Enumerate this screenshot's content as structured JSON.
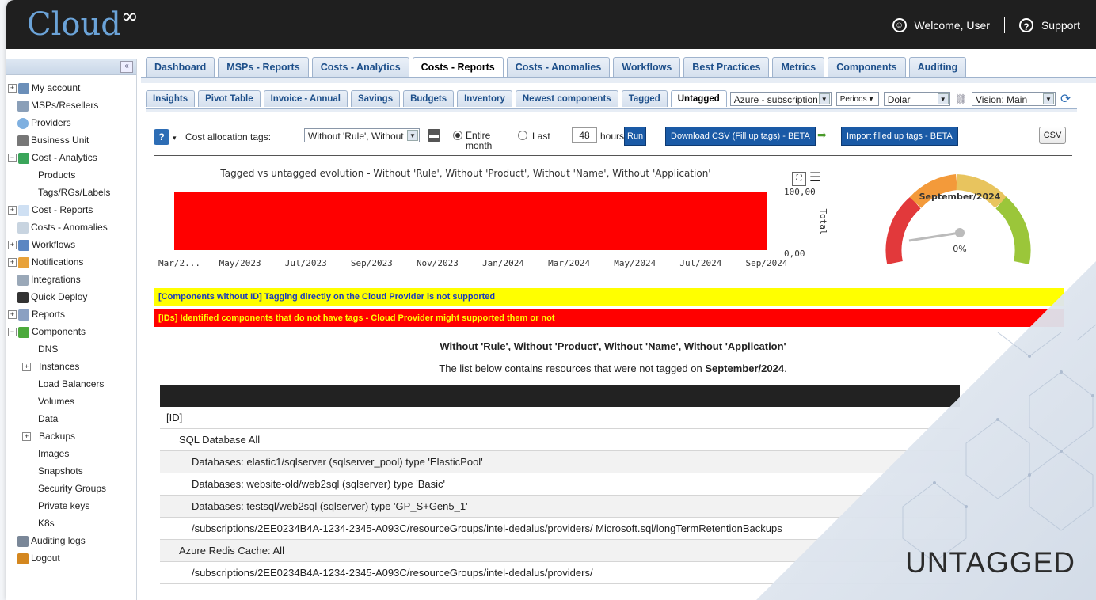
{
  "header": {
    "logo": "Cloud",
    "logo_symbol": "∞",
    "welcome": "Welcome, User",
    "support": "Support"
  },
  "sidebar": {
    "items": [
      {
        "label": "My account",
        "exp": "+",
        "icon": "user-icon"
      },
      {
        "label": "MSPs/Resellers",
        "exp": "",
        "icon": "msp-icon"
      },
      {
        "label": "Providers",
        "exp": "",
        "icon": "cloud-icon"
      },
      {
        "label": "Business Unit",
        "exp": "",
        "icon": "org-icon"
      },
      {
        "label": "Cost - Analytics",
        "exp": "−",
        "icon": "dollar-icon"
      },
      {
        "label": "Products",
        "exp": "",
        "icon": ""
      },
      {
        "label": "Tags/RGs/Labels",
        "exp": "",
        "icon": ""
      },
      {
        "label": "Cost - Reports",
        "exp": "+",
        "icon": "document-icon"
      },
      {
        "label": "Costs - Anomalies",
        "exp": "",
        "icon": "magnifier-icon"
      },
      {
        "label": "Workflows",
        "exp": "+",
        "icon": "workflow-icon"
      },
      {
        "label": "Notifications",
        "exp": "+",
        "icon": "bell-icon"
      },
      {
        "label": "Integrations",
        "exp": "",
        "icon": "integration-icon"
      },
      {
        "label": "Quick Deploy",
        "exp": "",
        "icon": "deploy-icon"
      },
      {
        "label": "Reports",
        "exp": "+",
        "icon": "report-icon"
      },
      {
        "label": "Components",
        "exp": "−",
        "icon": "puzzle-icon"
      },
      {
        "label": "DNS",
        "exp": "",
        "icon": ""
      },
      {
        "label": "Instances",
        "exp": "+",
        "icon": ""
      },
      {
        "label": "Load Balancers",
        "exp": "",
        "icon": ""
      },
      {
        "label": "Volumes",
        "exp": "",
        "icon": ""
      },
      {
        "label": "Data",
        "exp": "",
        "icon": ""
      },
      {
        "label": "Backups",
        "exp": "+",
        "icon": ""
      },
      {
        "label": "Images",
        "exp": "",
        "icon": ""
      },
      {
        "label": "Snapshots",
        "exp": "",
        "icon": ""
      },
      {
        "label": "Security Groups",
        "exp": "",
        "icon": ""
      },
      {
        "label": "Private keys",
        "exp": "",
        "icon": ""
      },
      {
        "label": "K8s",
        "exp": "",
        "icon": ""
      },
      {
        "label": "Auditing logs",
        "exp": "",
        "icon": "log-icon"
      },
      {
        "label": "Logout",
        "exp": "",
        "icon": "logout-icon"
      }
    ]
  },
  "tabs_main": [
    "Dashboard",
    "MSPs - Reports",
    "Costs - Analytics",
    "Costs - Reports",
    "Costs - Anomalies",
    "Workflows",
    "Best Practices",
    "Metrics",
    "Components",
    "Auditing"
  ],
  "tabs_sub": [
    "Insights",
    "Pivot Table",
    "Invoice - Annual",
    "Savings",
    "Budgets",
    "Inventory",
    "Newest components",
    "Tagged",
    "Untagged"
  ],
  "filters": {
    "subscription": "Azure - subscription",
    "periods": "Periods",
    "currency": "Dolar",
    "vision": "Vision: Main"
  },
  "controls": {
    "label": "Cost allocation tags:",
    "tags_value": "Without 'Rule', Without",
    "entire_month": "Entire month",
    "last": "Last",
    "hours_value": "48",
    "hours": "hours",
    "run": "Run",
    "download": "Download CSV (Fill up tags) - BETA",
    "import": "Import filled up tags - BETA",
    "csv": "CSV"
  },
  "chart_data": {
    "type": "area",
    "title": "Tagged vs untagged evolution - Without 'Rule', Without 'Product', Without 'Name', Without 'Application'",
    "x": [
      "Mar/2...",
      "May/2023",
      "Jul/2023",
      "Sep/2023",
      "Nov/2023",
      "Jan/2024",
      "Mar/2024",
      "May/2024",
      "Jul/2024",
      "Sep/2024"
    ],
    "series": [
      {
        "values": [
          100,
          100,
          100,
          100,
          100,
          100,
          100,
          100,
          100,
          100
        ],
        "color": "#ff0000"
      }
    ],
    "ylabel": "Total",
    "yticks": [
      "100,00",
      "0,00"
    ],
    "ylim": [
      0,
      100
    ]
  },
  "gauge": {
    "label": "September/2024",
    "value_text": "0%",
    "value": 0
  },
  "banners": {
    "yellow": "[Components without ID] Tagging directly on the Cloud Provider is not supported",
    "red": "[IDs] Identified components that do not have tags - Cloud Provider might supported them or not"
  },
  "list": {
    "title": "Without 'Rule', Without 'Product', Without 'Name', Without 'Application'",
    "sub_prefix": "The list below contains resources that were not tagged on ",
    "sub_month": "September/2024",
    "sub_suffix": ".",
    "rows": [
      {
        "text": "[ID]",
        "indent": 0,
        "alt": false
      },
      {
        "text": "SQL Database All",
        "indent": 1,
        "alt": false
      },
      {
        "text": "Databases: elastic1/sqlserver (sqlserver_pool) type 'ElasticPool'",
        "indent": 2,
        "alt": true
      },
      {
        "text": "Databases: website-old/web2sql (sqlserver) type 'Basic'",
        "indent": 2,
        "alt": false
      },
      {
        "text": "Databases: testsql/web2sql (sqlserver) type 'GP_S+Gen5_1'",
        "indent": 2,
        "alt": true
      },
      {
        "text": "/subscriptions/2EE0234B4A-1234-2345-A093C/resourceGroups/intel-dedalus/providers/ Microsoft.sql/longTermRetentionBackups",
        "indent": 2,
        "alt": false
      },
      {
        "text": "Azure Redis Cache: All",
        "indent": 1,
        "alt": true
      },
      {
        "text": "/subscriptions/2EE0234B4A-1234-2345-A093C/resourceGroups/intel-dedalus/providers/",
        "indent": 2,
        "alt": false
      }
    ]
  },
  "overlay_text": "UNTAGGED"
}
